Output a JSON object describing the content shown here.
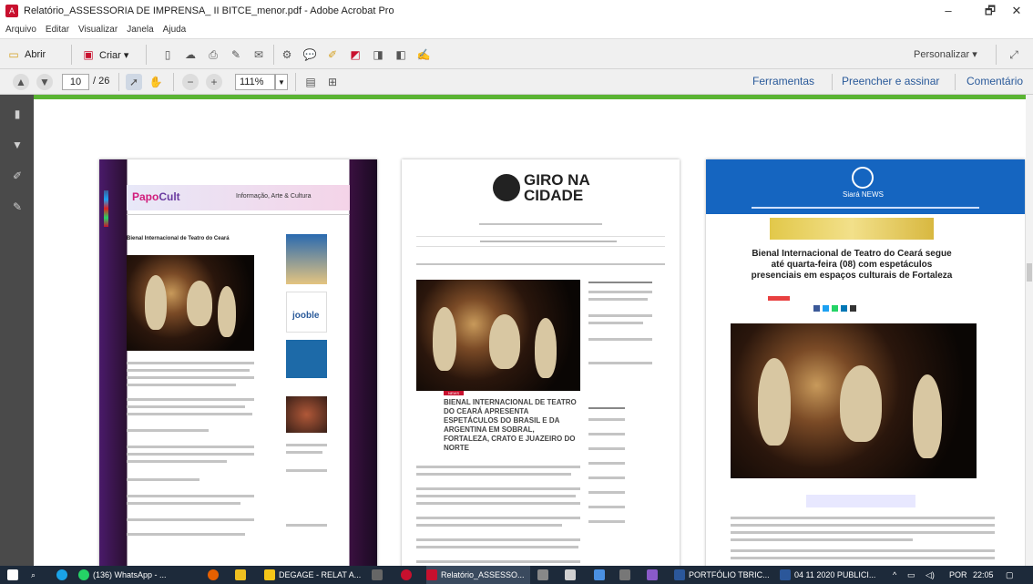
{
  "window": {
    "title": "Relatório_ASSESSORIA DE IMPRENSA_ II BITCE_menor.pdf - Adobe Acrobat Pro",
    "min_glyph": "–",
    "max_glyph": "🗗",
    "close_glyph": "✕"
  },
  "menu": [
    "Arquivo",
    "Editar",
    "Visualizar",
    "Janela",
    "Ajuda"
  ],
  "toolbar": {
    "open_label": "Abrir",
    "create_label": "Criar ▾",
    "customize_label": "Personalizar ▾"
  },
  "nav": {
    "page_current": "10",
    "page_total": "/ 26",
    "zoom": "111%",
    "tools_label": "Ferramentas",
    "fill_sign_label": "Preencher e assinar",
    "comment_label": "Comentário"
  },
  "page1": {
    "logo_a": "Papo",
    "logo_b": "Cult",
    "tagline": "Informação, Arte & Cultura",
    "headline": "Bienal Internacional de Teatro do Ceará",
    "ad_jooble": "jooble"
  },
  "page2": {
    "logo_line1": "GIRO NA",
    "logo_line2": "CIDADE",
    "tag": "NEWS",
    "headline": "BIENAL INTERNACIONAL DE TEATRO DO CEARÁ APRESENTA ESPETÁCULOS DO BRASIL E DA ARGENTINA EM SOBRAL, FORTALEZA, CRATO E JUAZEIRO DO NORTE"
  },
  "page3": {
    "logo": "Siará NEWS",
    "headline": "Bienal Internacional de Teatro do Ceará segue até quarta-feira (08) com espetáculos presenciais em espaços culturais de Fortaleza"
  },
  "taskbar": {
    "whatsapp": "(136) WhatsApp - ...",
    "degage": "DEGAGE - RELAT A...",
    "relatorio": "Relatório_ASSESSO...",
    "portfolio": "PORTFÓLIO TBRIC...",
    "publico": "04 11 2020 PUBLICI...",
    "lang": "POR",
    "time": "22:05"
  },
  "colors": {
    "green_bar": "#5ab433",
    "link_blue": "#2a5a9a",
    "siara_blue": "#1565c0",
    "taskbar": "#1d2a3a"
  }
}
